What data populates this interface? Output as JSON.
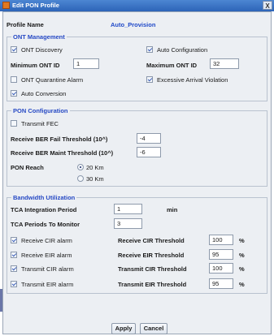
{
  "window": {
    "title": "Edit PON Profile",
    "close_label": "X"
  },
  "profile": {
    "label": "Profile Name",
    "value": "Auto_Provision"
  },
  "ont": {
    "title": "ONT Management",
    "discovery": "ONT Discovery",
    "auto_config": "Auto Configuration",
    "min_label": "Minimum ONT ID",
    "min_value": "1",
    "max_label": "Maximum ONT ID",
    "max_value": "32",
    "quarantine": "ONT Quarantine Alarm",
    "excessive": "Excessive Arrival Violation",
    "conversion": "Auto Conversion"
  },
  "pon": {
    "title": "PON Configuration",
    "fec": "Transmit FEC",
    "fail_label": "Receive BER Fail Threshold (10^)",
    "fail_value": "-4",
    "maint_label": "Receive BER Maint Threshold (10^)",
    "maint_value": "-6",
    "reach_label": "PON Reach",
    "reach_20": "20 Km",
    "reach_30": "30 Km"
  },
  "bw": {
    "title": "Bandwidth Utilization",
    "tca_period_label": "TCA Integration Period",
    "tca_period_value": "1",
    "tca_period_unit": "min",
    "tca_monitor_label": "TCA Periods To Monitor",
    "tca_monitor_value": "3",
    "alarms": [
      {
        "check": "Receive CIR alarm",
        "threshold": "Receive CIR Threshold",
        "value": "100",
        "unit": "%"
      },
      {
        "check": "Receive EIR alarm",
        "threshold": "Receive EIR Threshold",
        "value": "95",
        "unit": "%"
      },
      {
        "check": "Transmit CIR alarm",
        "threshold": "Transmit CIR Threshold",
        "value": "100",
        "unit": "%"
      },
      {
        "check": "Transmit EIR alarm",
        "threshold": "Transmit EIR Threshold",
        "value": "95",
        "unit": "%"
      }
    ]
  },
  "buttons": {
    "apply": "Apply",
    "cancel": "Cancel"
  }
}
